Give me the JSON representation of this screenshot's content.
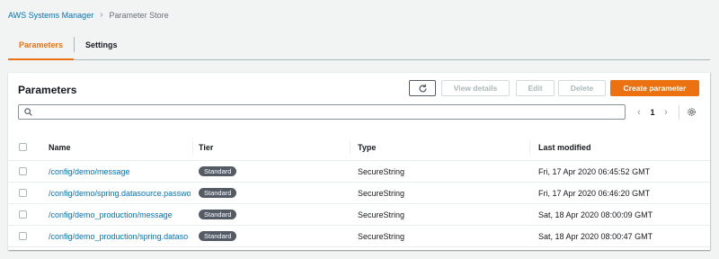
{
  "breadcrumb": {
    "root": "AWS Systems Manager",
    "current": "Parameter Store"
  },
  "tabs": [
    {
      "label": "Parameters",
      "active": true
    },
    {
      "label": "Settings",
      "active": false
    }
  ],
  "panel": {
    "title": "Parameters",
    "buttons": {
      "refresh_icon": "refresh-icon",
      "view_details": "View details",
      "edit": "Edit",
      "delete": "Delete",
      "create": "Create parameter"
    },
    "search": {
      "placeholder": ""
    },
    "pagination": {
      "page": "1"
    },
    "columns": {
      "name": "Name",
      "tier": "Tier",
      "type": "Type",
      "last_modified": "Last modified"
    },
    "rows": [
      {
        "name": "/config/demo/message",
        "tier": "Standard",
        "type": "SecureString",
        "modified": "Fri, 17 Apr 2020 06:45:52 GMT"
      },
      {
        "name": "/config/demo/spring.datasource.passwo",
        "tier": "Standard",
        "type": "SecureString",
        "modified": "Fri, 17 Apr 2020 06:46:20 GMT"
      },
      {
        "name": "/config/demo_production/message",
        "tier": "Standard",
        "type": "SecureString",
        "modified": "Sat, 18 Apr 2020 08:00:09 GMT"
      },
      {
        "name": "/config/demo_production/spring.dataso",
        "tier": "Standard",
        "type": "SecureString",
        "modified": "Sat, 18 Apr 2020 08:00:47 GMT"
      }
    ]
  },
  "colors": {
    "accent": "#ec7211",
    "link": "#0073bb",
    "badge": "#545b64"
  }
}
